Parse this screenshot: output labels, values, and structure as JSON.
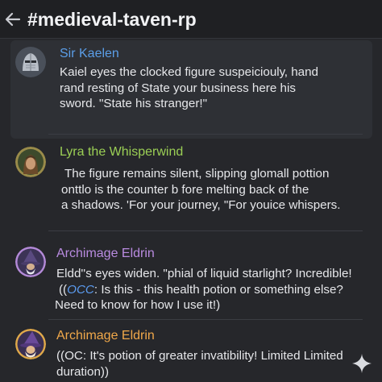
{
  "header": {
    "back_icon": "back-arrow-icon",
    "channel_name": "#medieval-taven-rp"
  },
  "colors": {
    "background": "#26272b",
    "header_background": "#1f2023",
    "author_sir_kaelen": "#5b9ee8",
    "author_lyra": "#9bcf55",
    "author_archimage_1": "#b98be0",
    "author_archimage_2": "#f0a84a",
    "occ_highlight": "#5b9bf0"
  },
  "messages": [
    {
      "author": "Sir Kaelen",
      "avatar_icon": "knight-helmet-avatar-icon",
      "lines": [
        "Kaiel eyes the clocked figure suspeicioulу, hand",
        "rand resting of State your business here his",
        "sword. \"State his stranger!\""
      ]
    },
    {
      "author": "Lyra the Whisperwind",
      "avatar_icon": "elf-ranger-avatar-icon",
      "lines": [
        "The figure remains silent, slipping glomall pottion",
        "onttlo is the counter b fore melting back of the",
        "a shadows. 'For your journey, \"For youice whispers."
      ]
    },
    {
      "author": "Archimage Eldrin",
      "avatar_icon": "wizard-avatar-icon",
      "line1": "Eldd''s eyes widen. \"phial of liquid starlight? Incredible!",
      "line2_prefix": "((",
      "line2_occ": "OCC",
      "line2_rest": ":  Is this - this health potion or something else?",
      "line3": "Need to know for how I use it!)"
    },
    {
      "author": "Archimage Eldrin",
      "avatar_icon": "wizard-hat-avatar-icon",
      "lines": [
        "((OC: It's potion of greater invatibility! Limited Limited",
        "duration))"
      ]
    }
  ],
  "fab_icon": "sparkle-icon"
}
